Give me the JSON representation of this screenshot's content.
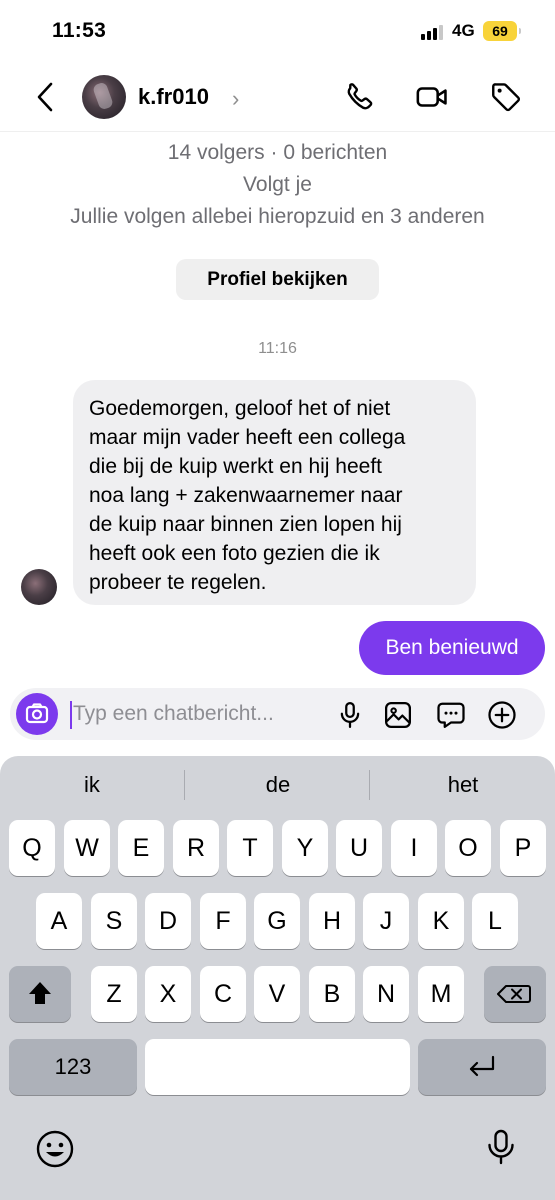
{
  "status_bar": {
    "time": "11:53",
    "network": "4G",
    "battery": "69",
    "icons": [
      "signal-icon",
      "battery-icon"
    ]
  },
  "header": {
    "username": "k.fr010",
    "chevron": "›",
    "icons": [
      "back-arrow-icon",
      "phone-icon",
      "video-camera-icon",
      "tag-icon"
    ]
  },
  "profile_info": {
    "stats": "14 volgers · 0 berichten",
    "follows_you": "Volgt je",
    "mutual": "Jullie volgen allebei hieropzuid en 3 anderen",
    "view_profile": "Profiel bekijken"
  },
  "thread": {
    "timestamp": "11:16",
    "messages": [
      {
        "direction": "incoming",
        "lines": [
          "Goedemorgen, geloof het of niet",
          "maar mijn vader heeft een collega",
          "die bij de kuip werkt en hij heeft",
          "noa lang + zakenwaarnemer naar",
          "de kuip naar binnen zien lopen hij",
          "heeft ook een foto gezien die ik",
          "probeer te regelen."
        ]
      },
      {
        "direction": "outgoing",
        "text": "Ben benieuwd"
      }
    ]
  },
  "composer": {
    "placeholder": "Typ een chatbericht...",
    "value": "",
    "icons": [
      "camera-icon",
      "microphone-icon",
      "gallery-icon",
      "sticker-icon",
      "plus-circle-icon"
    ]
  },
  "keyboard": {
    "suggestions": [
      "ik",
      "de",
      "het"
    ],
    "row1": [
      "Q",
      "W",
      "E",
      "R",
      "T",
      "Y",
      "U",
      "I",
      "O",
      "P"
    ],
    "row2": [
      "A",
      "S",
      "D",
      "F",
      "G",
      "H",
      "J",
      "K",
      "L"
    ],
    "row3": [
      "Z",
      "X",
      "C",
      "V",
      "B",
      "N",
      "M"
    ],
    "numbers_key": "123",
    "space_key": "",
    "icons": [
      "shift-icon",
      "backspace-icon",
      "return-icon",
      "emoji-icon",
      "dictation-icon"
    ]
  },
  "colors": {
    "accent": "#7c3aed",
    "incoming_bubble": "#efeff1",
    "keyboard_bg": "#d2d4d9",
    "battery": "#f8d33a"
  }
}
